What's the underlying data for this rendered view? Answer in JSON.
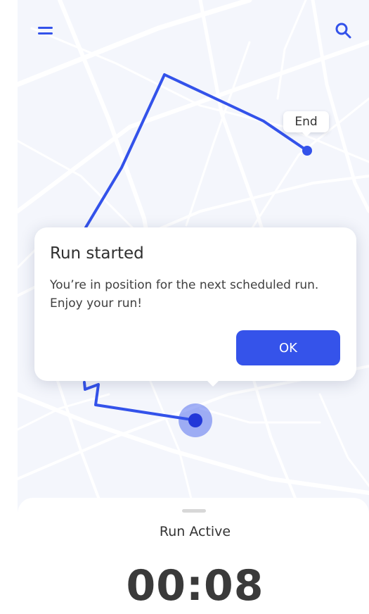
{
  "header": {
    "menu_icon": "hamburger-menu-icon",
    "search_icon": "search-icon"
  },
  "map": {
    "route_color": "#3352ea",
    "end_label": "End"
  },
  "dialog": {
    "title": "Run started",
    "message": "You’re in position for the next scheduled run. Enjoy your run!",
    "ok_label": "OK",
    "button_color": "#3553ea"
  },
  "bottom_sheet": {
    "status": "Run Active",
    "timer": "00:08"
  }
}
